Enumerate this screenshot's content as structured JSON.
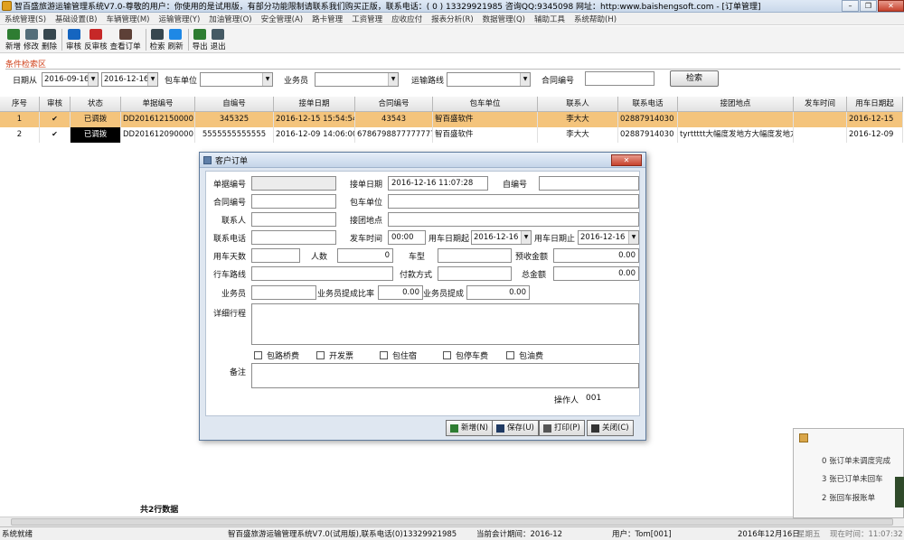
{
  "window": {
    "title": "智百盛旅游运输管理系统V7.0-尊敬的用户：你使用的是试用版，有部分功能限制请联系我们购买正版，联系电话：( 0 ) 13329921985 咨询QQ:9345098 网址：http:www.baishengsoft.com - [订单管理]",
    "buttons": [
      "–",
      "❐",
      "✕"
    ]
  },
  "menu": [
    "系统管理(S)",
    "基础设置(B)",
    "车辆管理(M)",
    "运输管理(Y)",
    "加油管理(O)",
    "安全管理(A)",
    "路卡管理",
    "工资管理",
    "应收应付",
    "报表分析(R)",
    "数据管理(Q)",
    "辅助工具",
    "系统帮助(H)"
  ],
  "toolbar": [
    {
      "label": "新增",
      "icon": "new-icon",
      "color": "#2e7d32"
    },
    {
      "label": "修改",
      "icon": "edit-icon",
      "color": "#546e7a"
    },
    {
      "label": "删除",
      "icon": "delete-icon",
      "color": "#37474f"
    },
    {
      "label": "审核",
      "icon": "audit-icon",
      "color": "#1565c0"
    },
    {
      "label": "反审核",
      "icon": "unaudit-icon",
      "color": "#c62828"
    },
    {
      "label": "查看订单",
      "icon": "view-order-icon",
      "color": "#5d4037"
    },
    {
      "label": "检索",
      "icon": "search-icon",
      "color": "#37474f"
    },
    {
      "label": "刷新",
      "icon": "refresh-icon",
      "color": "#1e88e5"
    },
    {
      "label": "导出",
      "icon": "export-icon",
      "color": "#2e7d32"
    },
    {
      "label": "退出",
      "icon": "exit-icon",
      "color": "#455a64"
    }
  ],
  "search": {
    "title": "条件检索区",
    "date_from_label": "日期从",
    "date_from": "2016-09-16",
    "date_to": "2016-12-16",
    "charter_label": "包车单位",
    "charter_value": "",
    "salesman_label": "业务员",
    "salesman_value": "",
    "route_label": "运输路线",
    "route_value": "",
    "contract_label": "合同编号",
    "contract_value": "",
    "search_button": "检索"
  },
  "grid": {
    "columns": [
      "序号",
      "审核",
      "状态",
      "单据编号",
      "自编号",
      "接单日期",
      "合同编号",
      "包车单位",
      "联系人",
      "联系电话",
      "接团地点",
      "发车时间",
      "用车日期起"
    ],
    "rows": [
      {
        "no": "1",
        "audit": "✔",
        "status": "已调拨",
        "doc_no": "DD2016121500001",
        "self_no": "345325",
        "order_date": "2016-12-15 15:54:54",
        "contract": "43543",
        "charter": "智百盛软件",
        "contact": "李大大",
        "phone": "02887914030",
        "pickup": "",
        "depart": "",
        "start_date": "2016-12-15"
      },
      {
        "no": "2",
        "audit": "✔",
        "status": "已调拨",
        "doc_no": "DD2016120900001",
        "self_no": "5555555555555",
        "order_date": "2016-12-09 14:06:00",
        "contract": "6786798877777777777",
        "charter": "智百盛软件",
        "contact": "李大大",
        "phone": "02887914030",
        "pickup": "tyrttttt大幅度发地方大幅度发地方大",
        "depart": "",
        "start_date": "2016-12-09"
      }
    ],
    "total": "共2行数据"
  },
  "dialog": {
    "title": "客户订单",
    "close": "✕",
    "labels": {
      "doc_no": "单据编号",
      "order_date": "接单日期",
      "self_no": "自编号",
      "contract": "合同编号",
      "charter": "包车单位",
      "contact": "联系人",
      "pickup": "接团地点",
      "phone": "联系电话",
      "depart_time": "发车时间",
      "use_from": "用车日期起",
      "use_to": "用车日期止",
      "days": "用车天数",
      "people": "人数",
      "car_type": "车型",
      "prepay": "预收金额",
      "route": "行车路线",
      "pay_method": "付款方式",
      "total": "总金额",
      "salesman": "业务员",
      "commission_rate": "业务员提成比率",
      "commission": "业务员提成",
      "itinerary": "详细行程",
      "remark": "备注",
      "operator": "操作人"
    },
    "values": {
      "order_date": "2016-12-16 11:07:28",
      "depart_time": "00:00",
      "use_from": "2016-12-16",
      "use_to": "2016-12-16",
      "people": "0",
      "prepay": "0.00",
      "total": "0.00",
      "commission_rate": "0.00",
      "commission": "0.00",
      "operator": "001"
    },
    "checkboxes": [
      "包路桥费",
      "开发票",
      "包住宿",
      "包停车费",
      "包油费"
    ],
    "buttons": {
      "new": "新增(N)",
      "save": "保存(U)",
      "print": "打印(P)",
      "close": "关闭(C)"
    }
  },
  "notification": {
    "lines": [
      "0 张订单未调度完成",
      "3 张已订单未回车",
      "2 张回车报账单"
    ]
  },
  "statusbar": {
    "ready": "系统就绪",
    "app": "智百盛旅游运输管理系统V7.0(试用版),联系电话(0)13329921985",
    "period": "当前会计期间：2016-12",
    "user": "用户：Tom[001]",
    "date": "2016年12月16日",
    "weekday": "星期五",
    "time": "现在时间：11:07:32"
  }
}
